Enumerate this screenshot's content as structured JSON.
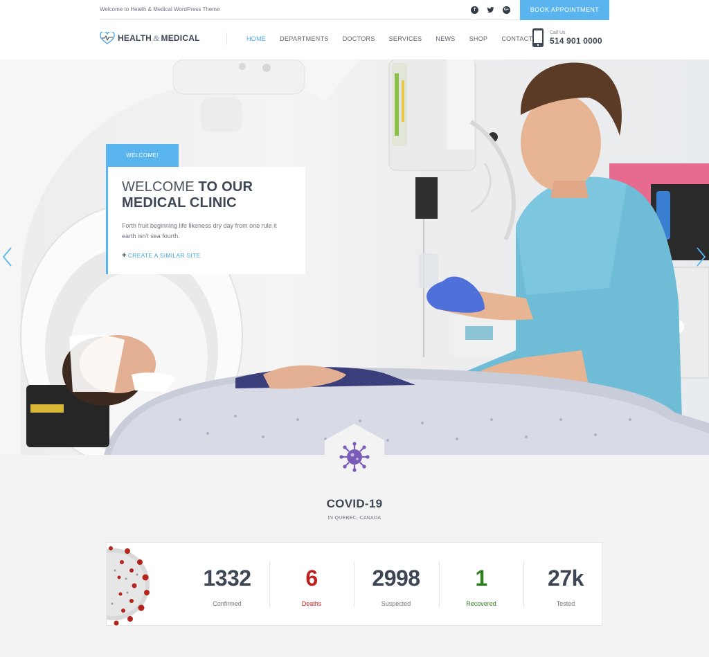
{
  "topbar": {
    "welcome": "Welcome to Health & Medical WordPress Theme",
    "socials": [
      {
        "icon": "facebook-icon",
        "glyph": "f"
      },
      {
        "icon": "twitter-icon",
        "glyph": "t"
      },
      {
        "icon": "google-plus-icon",
        "glyph": "G+"
      }
    ],
    "cta": "BOOK APPOINTMENT"
  },
  "header": {
    "logo_left": "HEALTH",
    "logo_amp": "&",
    "logo_right": "MEDICAL",
    "nav": [
      "HOME",
      "DEPARTMENTS",
      "DOCTORS",
      "SERVICES",
      "NEWS",
      "SHOP",
      "CONTACT"
    ],
    "active_nav": "HOME",
    "call_label": "Call Us",
    "call_number": "514 901 0000"
  },
  "hero": {
    "tag": "WELCOME!",
    "title_light": "WELCOME ",
    "title_bold": "TO OUR MEDICAL CLINIC",
    "description": "Forth fruit beginning life likeness dry day from one rule it earth isn't sea fourth.",
    "link_plus": "+",
    "link": "CREATE A SIMILAR SITE"
  },
  "covid": {
    "title": "COVID-19",
    "subtitle": "IN QUEBEC, CANADA",
    "stats": [
      {
        "value": "1332",
        "label": "Confirmed",
        "color": "#3d4654"
      },
      {
        "value": "6",
        "label": "Deaths",
        "color": "#c0201d"
      },
      {
        "value": "2998",
        "label": "Suspected",
        "color": "#3d4654"
      },
      {
        "value": "1",
        "label": "Recovered",
        "color": "#2e7d1e"
      },
      {
        "value": "27k",
        "label": "Tested",
        "color": "#3d4654"
      }
    ]
  },
  "colors": {
    "accent": "#5ab4ee",
    "text_dark": "#3d4654",
    "deaths": "#c0201d",
    "recovered": "#2e7d1e",
    "virus": "#7b5bb8"
  }
}
